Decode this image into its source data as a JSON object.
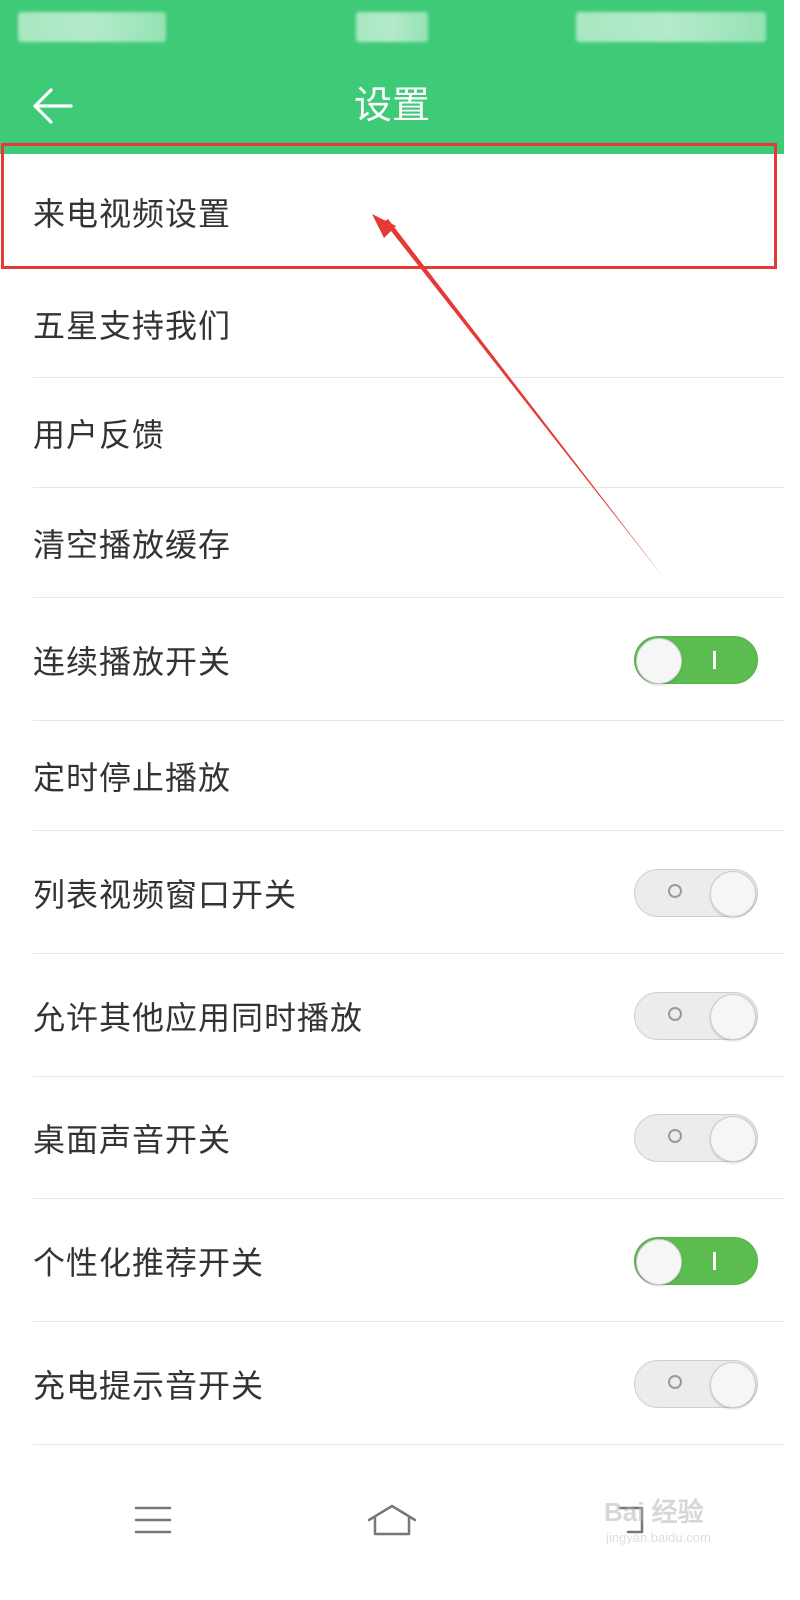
{
  "colors": {
    "accent": "#3fca78",
    "toggle_on": "#5bbd4f",
    "toggle_off": "#ececec",
    "highlight": "#e53935"
  },
  "app_bar": {
    "title": "设置",
    "back_icon": "arrow-left-icon"
  },
  "settings": {
    "items": [
      {
        "label": "来电视频设置",
        "has_toggle": false
      },
      {
        "label": "五星支持我们",
        "has_toggle": false
      },
      {
        "label": "用户反馈",
        "has_toggle": false
      },
      {
        "label": "清空播放缓存",
        "has_toggle": false
      },
      {
        "label": "连续播放开关",
        "has_toggle": true,
        "on": true
      },
      {
        "label": "定时停止播放",
        "has_toggle": false
      },
      {
        "label": "列表视频窗口开关",
        "has_toggle": true,
        "on": false
      },
      {
        "label": "允许其他应用同时播放",
        "has_toggle": true,
        "on": false
      },
      {
        "label": "桌面声音开关",
        "has_toggle": true,
        "on": false
      },
      {
        "label": "个性化推荐开关",
        "has_toggle": true,
        "on": true
      },
      {
        "label": "充电提示音开关",
        "has_toggle": true,
        "on": false
      }
    ]
  },
  "annotation": {
    "highlighted_item": "来电视频设置"
  },
  "nav_bar": {
    "icons": [
      "menu-icon",
      "home-icon",
      "back-icon"
    ]
  },
  "watermark": {
    "main": "Bai 经验",
    "sub": "jingyan.baidu.com"
  }
}
